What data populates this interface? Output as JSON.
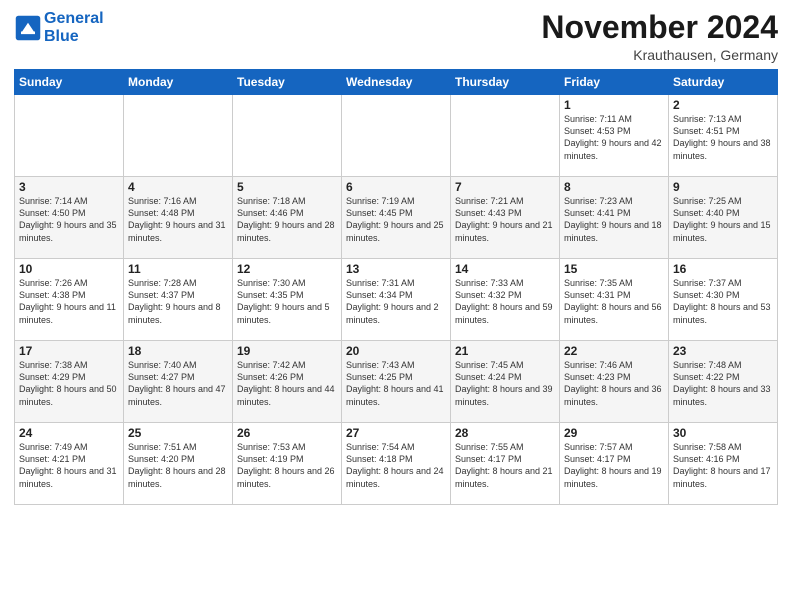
{
  "header": {
    "logo_line1": "General",
    "logo_line2": "Blue",
    "month": "November 2024",
    "location": "Krauthausen, Germany"
  },
  "days_of_week": [
    "Sunday",
    "Monday",
    "Tuesday",
    "Wednesday",
    "Thursday",
    "Friday",
    "Saturday"
  ],
  "weeks": [
    [
      {
        "day": "",
        "info": ""
      },
      {
        "day": "",
        "info": ""
      },
      {
        "day": "",
        "info": ""
      },
      {
        "day": "",
        "info": ""
      },
      {
        "day": "",
        "info": ""
      },
      {
        "day": "1",
        "info": "Sunrise: 7:11 AM\nSunset: 4:53 PM\nDaylight: 9 hours and 42 minutes."
      },
      {
        "day": "2",
        "info": "Sunrise: 7:13 AM\nSunset: 4:51 PM\nDaylight: 9 hours and 38 minutes."
      }
    ],
    [
      {
        "day": "3",
        "info": "Sunrise: 7:14 AM\nSunset: 4:50 PM\nDaylight: 9 hours and 35 minutes."
      },
      {
        "day": "4",
        "info": "Sunrise: 7:16 AM\nSunset: 4:48 PM\nDaylight: 9 hours and 31 minutes."
      },
      {
        "day": "5",
        "info": "Sunrise: 7:18 AM\nSunset: 4:46 PM\nDaylight: 9 hours and 28 minutes."
      },
      {
        "day": "6",
        "info": "Sunrise: 7:19 AM\nSunset: 4:45 PM\nDaylight: 9 hours and 25 minutes."
      },
      {
        "day": "7",
        "info": "Sunrise: 7:21 AM\nSunset: 4:43 PM\nDaylight: 9 hours and 21 minutes."
      },
      {
        "day": "8",
        "info": "Sunrise: 7:23 AM\nSunset: 4:41 PM\nDaylight: 9 hours and 18 minutes."
      },
      {
        "day": "9",
        "info": "Sunrise: 7:25 AM\nSunset: 4:40 PM\nDaylight: 9 hours and 15 minutes."
      }
    ],
    [
      {
        "day": "10",
        "info": "Sunrise: 7:26 AM\nSunset: 4:38 PM\nDaylight: 9 hours and 11 minutes."
      },
      {
        "day": "11",
        "info": "Sunrise: 7:28 AM\nSunset: 4:37 PM\nDaylight: 9 hours and 8 minutes."
      },
      {
        "day": "12",
        "info": "Sunrise: 7:30 AM\nSunset: 4:35 PM\nDaylight: 9 hours and 5 minutes."
      },
      {
        "day": "13",
        "info": "Sunrise: 7:31 AM\nSunset: 4:34 PM\nDaylight: 9 hours and 2 minutes."
      },
      {
        "day": "14",
        "info": "Sunrise: 7:33 AM\nSunset: 4:32 PM\nDaylight: 8 hours and 59 minutes."
      },
      {
        "day": "15",
        "info": "Sunrise: 7:35 AM\nSunset: 4:31 PM\nDaylight: 8 hours and 56 minutes."
      },
      {
        "day": "16",
        "info": "Sunrise: 7:37 AM\nSunset: 4:30 PM\nDaylight: 8 hours and 53 minutes."
      }
    ],
    [
      {
        "day": "17",
        "info": "Sunrise: 7:38 AM\nSunset: 4:29 PM\nDaylight: 8 hours and 50 minutes."
      },
      {
        "day": "18",
        "info": "Sunrise: 7:40 AM\nSunset: 4:27 PM\nDaylight: 8 hours and 47 minutes."
      },
      {
        "day": "19",
        "info": "Sunrise: 7:42 AM\nSunset: 4:26 PM\nDaylight: 8 hours and 44 minutes."
      },
      {
        "day": "20",
        "info": "Sunrise: 7:43 AM\nSunset: 4:25 PM\nDaylight: 8 hours and 41 minutes."
      },
      {
        "day": "21",
        "info": "Sunrise: 7:45 AM\nSunset: 4:24 PM\nDaylight: 8 hours and 39 minutes."
      },
      {
        "day": "22",
        "info": "Sunrise: 7:46 AM\nSunset: 4:23 PM\nDaylight: 8 hours and 36 minutes."
      },
      {
        "day": "23",
        "info": "Sunrise: 7:48 AM\nSunset: 4:22 PM\nDaylight: 8 hours and 33 minutes."
      }
    ],
    [
      {
        "day": "24",
        "info": "Sunrise: 7:49 AM\nSunset: 4:21 PM\nDaylight: 8 hours and 31 minutes."
      },
      {
        "day": "25",
        "info": "Sunrise: 7:51 AM\nSunset: 4:20 PM\nDaylight: 8 hours and 28 minutes."
      },
      {
        "day": "26",
        "info": "Sunrise: 7:53 AM\nSunset: 4:19 PM\nDaylight: 8 hours and 26 minutes."
      },
      {
        "day": "27",
        "info": "Sunrise: 7:54 AM\nSunset: 4:18 PM\nDaylight: 8 hours and 24 minutes."
      },
      {
        "day": "28",
        "info": "Sunrise: 7:55 AM\nSunset: 4:17 PM\nDaylight: 8 hours and 21 minutes."
      },
      {
        "day": "29",
        "info": "Sunrise: 7:57 AM\nSunset: 4:17 PM\nDaylight: 8 hours and 19 minutes."
      },
      {
        "day": "30",
        "info": "Sunrise: 7:58 AM\nSunset: 4:16 PM\nDaylight: 8 hours and 17 minutes."
      }
    ]
  ]
}
